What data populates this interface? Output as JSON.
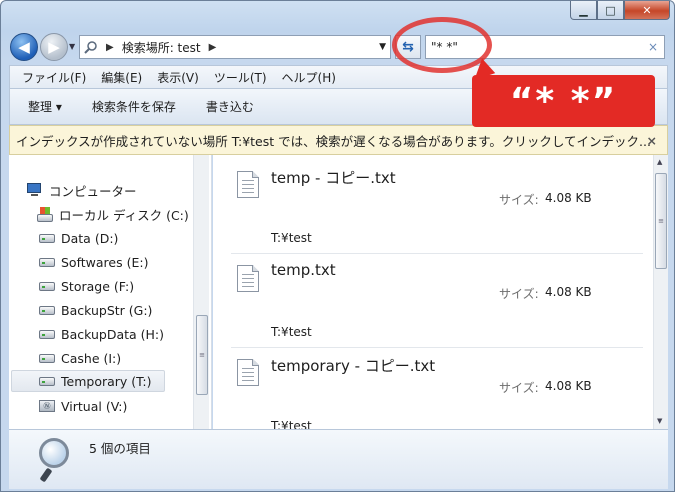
{
  "window": {
    "controls": {
      "minimize": "▁",
      "maximize": "□",
      "close": "✕"
    }
  },
  "nav": {
    "back_icon": "arrow-left-icon",
    "forward_icon": "arrow-right-icon",
    "back_glyph": "◀",
    "forward_glyph": "▶",
    "history_glyph": "▼"
  },
  "address": {
    "prefix": "検索場所: test",
    "sep": "▶",
    "dropdown": "▼"
  },
  "refresh_glyph": "⇆",
  "search": {
    "value": "\"* *\"",
    "clear": "×"
  },
  "menu": [
    "ファイル(F)",
    "編集(E)",
    "表示(V)",
    "ツール(T)",
    "ヘルプ(H)"
  ],
  "commands": {
    "organize": "整理 ▾",
    "save_search": "検索条件を保存",
    "burn": "書き込む"
  },
  "infobar": {
    "text": "インデックスが作成されていない場所 T:¥test では、検索が遅くなる場合があります。クリックしてインデック...",
    "close": "×"
  },
  "navpane": {
    "computer": "コンピューター",
    "drives": [
      {
        "label": "ローカル ディスク (C:)",
        "type": "system"
      },
      {
        "label": "Data (D:)",
        "type": "drive"
      },
      {
        "label": "Softwares (E:)",
        "type": "drive"
      },
      {
        "label": "Storage (F:)",
        "type": "drive"
      },
      {
        "label": "BackupStr (G:)",
        "type": "drive"
      },
      {
        "label": "BackupData (H:)",
        "type": "drive"
      },
      {
        "label": "Cashe (I:)",
        "type": "drive"
      },
      {
        "label": "Temporary (T:)",
        "type": "drive",
        "selected": true
      },
      {
        "label": "Virtual (V:)",
        "type": "network"
      }
    ]
  },
  "results": [
    {
      "name": "temp - コピー.txt",
      "size_label": "サイズ:",
      "size": "4.08 KB",
      "path": "T:¥test"
    },
    {
      "name": "temp.txt",
      "size_label": "サイズ:",
      "size": "4.08 KB",
      "path": "T:¥test"
    },
    {
      "name": "temporary - コピー.txt",
      "size_label": "サイズ:",
      "size": "4.08 KB",
      "path": "T:¥test"
    }
  ],
  "details": {
    "count": "5 個の項目"
  },
  "annotation": {
    "callout_text": "“* *”",
    "color": "#e32a25"
  },
  "scroll_glyphs": {
    "up": "▲",
    "down": "▼",
    "grip": "≡"
  }
}
